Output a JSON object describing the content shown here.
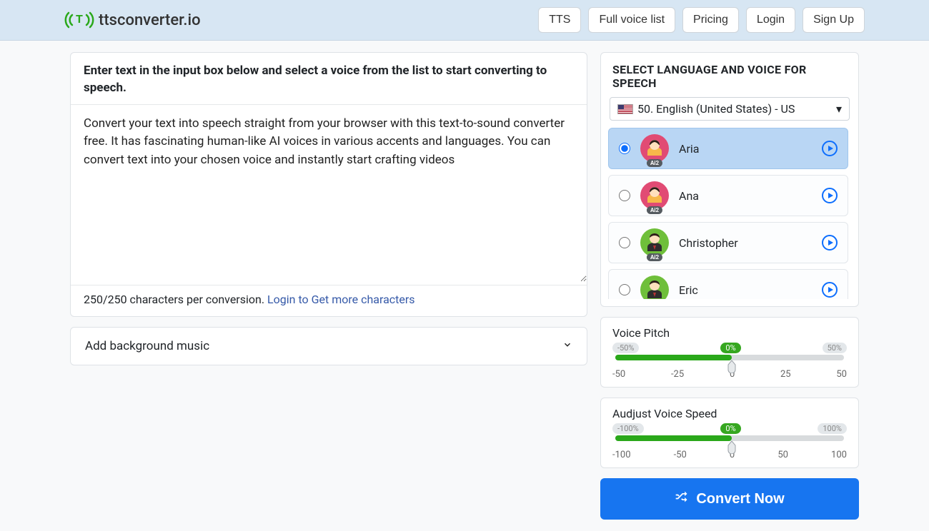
{
  "brand": {
    "name": "ttsconverter.io"
  },
  "nav": {
    "tts": "TTS",
    "full_voice_list": "Full voice list",
    "pricing": "Pricing",
    "login": "Login",
    "signup": "Sign Up"
  },
  "input": {
    "instruction": "Enter text in the input box below and select a voice from the list to start converting to speech.",
    "text": "Convert your text into speech straight from your browser with this text-to-sound converter free. It has fascinating human-like AI voices in various accents and languages. You can convert text into your chosen voice and instantly start crafting videos",
    "counter_prefix": "250/250 characters per conversion. ",
    "login_link": "Login to Get more characters"
  },
  "bgmusic": {
    "label": "Add background music"
  },
  "voice_panel": {
    "title": "SELECT LANGUAGE AND VOICE FOR SPEECH",
    "language": "50. English (United States) - US",
    "voices": [
      {
        "name": "Aria",
        "selected": true,
        "gender": "f",
        "color": "#e14b74"
      },
      {
        "name": "Ana",
        "selected": false,
        "gender": "f",
        "color": "#e14b74"
      },
      {
        "name": "Christopher",
        "selected": false,
        "gender": "m",
        "color": "#6fbf3a"
      },
      {
        "name": "Eric",
        "selected": false,
        "gender": "m",
        "color": "#6fbf3a"
      }
    ],
    "ai_badge": "Ai2"
  },
  "pitch": {
    "title": "Voice Pitch",
    "min_label": "-50%",
    "center_label": "0%",
    "max_label": "50%",
    "ticks": [
      "-50",
      "-25",
      "0",
      "25",
      "50"
    ]
  },
  "speed": {
    "title": "Audjust Voice Speed",
    "min_label": "-100%",
    "center_label": "0%",
    "max_label": "100%",
    "ticks": [
      "-100",
      "-50",
      "0",
      "50",
      "100"
    ]
  },
  "convert": {
    "label": "Convert Now"
  }
}
